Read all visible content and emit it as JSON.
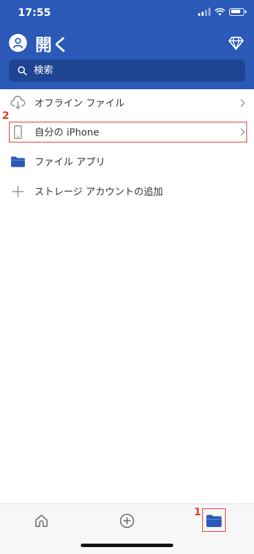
{
  "status_bar": {
    "time": "17:55"
  },
  "header": {
    "title": "開く",
    "search": {
      "placeholder": "検索"
    }
  },
  "list": {
    "items": [
      {
        "label": "オフライン ファイル"
      },
      {
        "label": "自分の iPhone"
      },
      {
        "label": "ファイル アプリ"
      },
      {
        "label": "ストレージ アカウントの追加"
      }
    ]
  },
  "annotations": {
    "step1": "1",
    "step2": "2"
  },
  "colors": {
    "header": "#2b59b8",
    "search_bg": "#1e4591",
    "highlight": "#e53935",
    "folder": "#2b59b8"
  },
  "icons": {
    "avatar": "person-icon",
    "premium": "diamond-icon",
    "search": "search-icon",
    "offline": "cloud-download-icon",
    "device": "phone-icon",
    "files_app": "folder-icon",
    "add": "plus-icon",
    "home": "home-icon",
    "new": "add-circle-icon",
    "open": "folder-icon"
  }
}
